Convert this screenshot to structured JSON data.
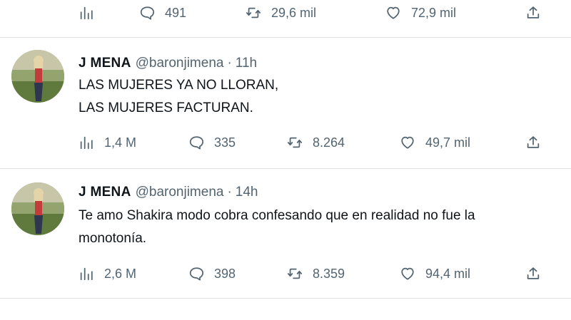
{
  "top_actions": {
    "views": "",
    "replies": "491",
    "retweets": "29,6 mil",
    "likes": "72,9 mil"
  },
  "tweets": [
    {
      "display_name": "J MENA",
      "handle": "@baronjimena",
      "separator": "·",
      "time": "11h",
      "text_lines": [
        "LAS MUJERES YA NO LLORAN,",
        "LAS MUJERES FACTURAN."
      ],
      "views": "1,4 M",
      "replies": "335",
      "retweets": "8.264",
      "likes": "49,7 mil"
    },
    {
      "display_name": "J MENA",
      "handle": "@baronjimena",
      "separator": "·",
      "time": "14h",
      "text_lines": [
        "Te amo Shakira modo cobra confesando que en realidad no fue la",
        "monotonía."
      ],
      "views": "2,6 M",
      "replies": "398",
      "retweets": "8.359",
      "likes": "94,4 mil"
    }
  ],
  "bottom_heading": "",
  "icons": {
    "views": "bar-chart-icon",
    "reply": "speech-bubble-icon",
    "retweet": "retweet-icon",
    "like": "heart-icon",
    "share": "share-upload-icon"
  },
  "colors": {
    "text": "#0f1419",
    "secondary": "#536471",
    "divider": "#dfe3e6"
  }
}
